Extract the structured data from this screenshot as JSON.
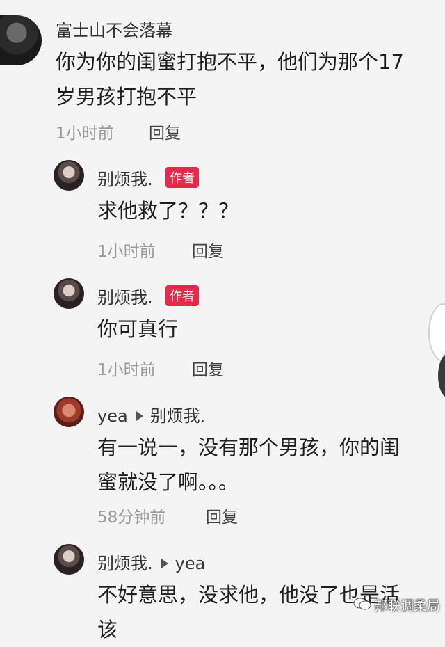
{
  "comments": [
    {
      "user": "富士山不会落幕",
      "text_lines": [
        "你为你的闺蜜打抱不平，他们为那个17",
        "岁男孩打抱不平"
      ],
      "time": "1小时前",
      "reply": "回复"
    },
    {
      "user": "别烦我.",
      "badge": "作者",
      "text": "求他救了？？？",
      "time": "1小时前",
      "reply": "回复"
    },
    {
      "user": "别烦我.",
      "badge": "作者",
      "text": "你可真行",
      "time": "1小时前",
      "reply": "回复"
    },
    {
      "user": "yea",
      "reply_to": "别烦我.",
      "text_lines": [
        "有一说一，没有那个男孩，你的闺",
        "蜜就没了啊。。。"
      ],
      "time": "58分钟前",
      "reply": "回复"
    },
    {
      "user": "别烦我.",
      "reply_to": "yea",
      "text_lines": [
        "不好意思，没求他，他没了也是活",
        "该"
      ]
    }
  ],
  "watermark": {
    "text": "邦联调柔局",
    "icon": "wechat-icon"
  },
  "colors": {
    "badge": "#e8294a",
    "meta": "#9a9a9a"
  }
}
